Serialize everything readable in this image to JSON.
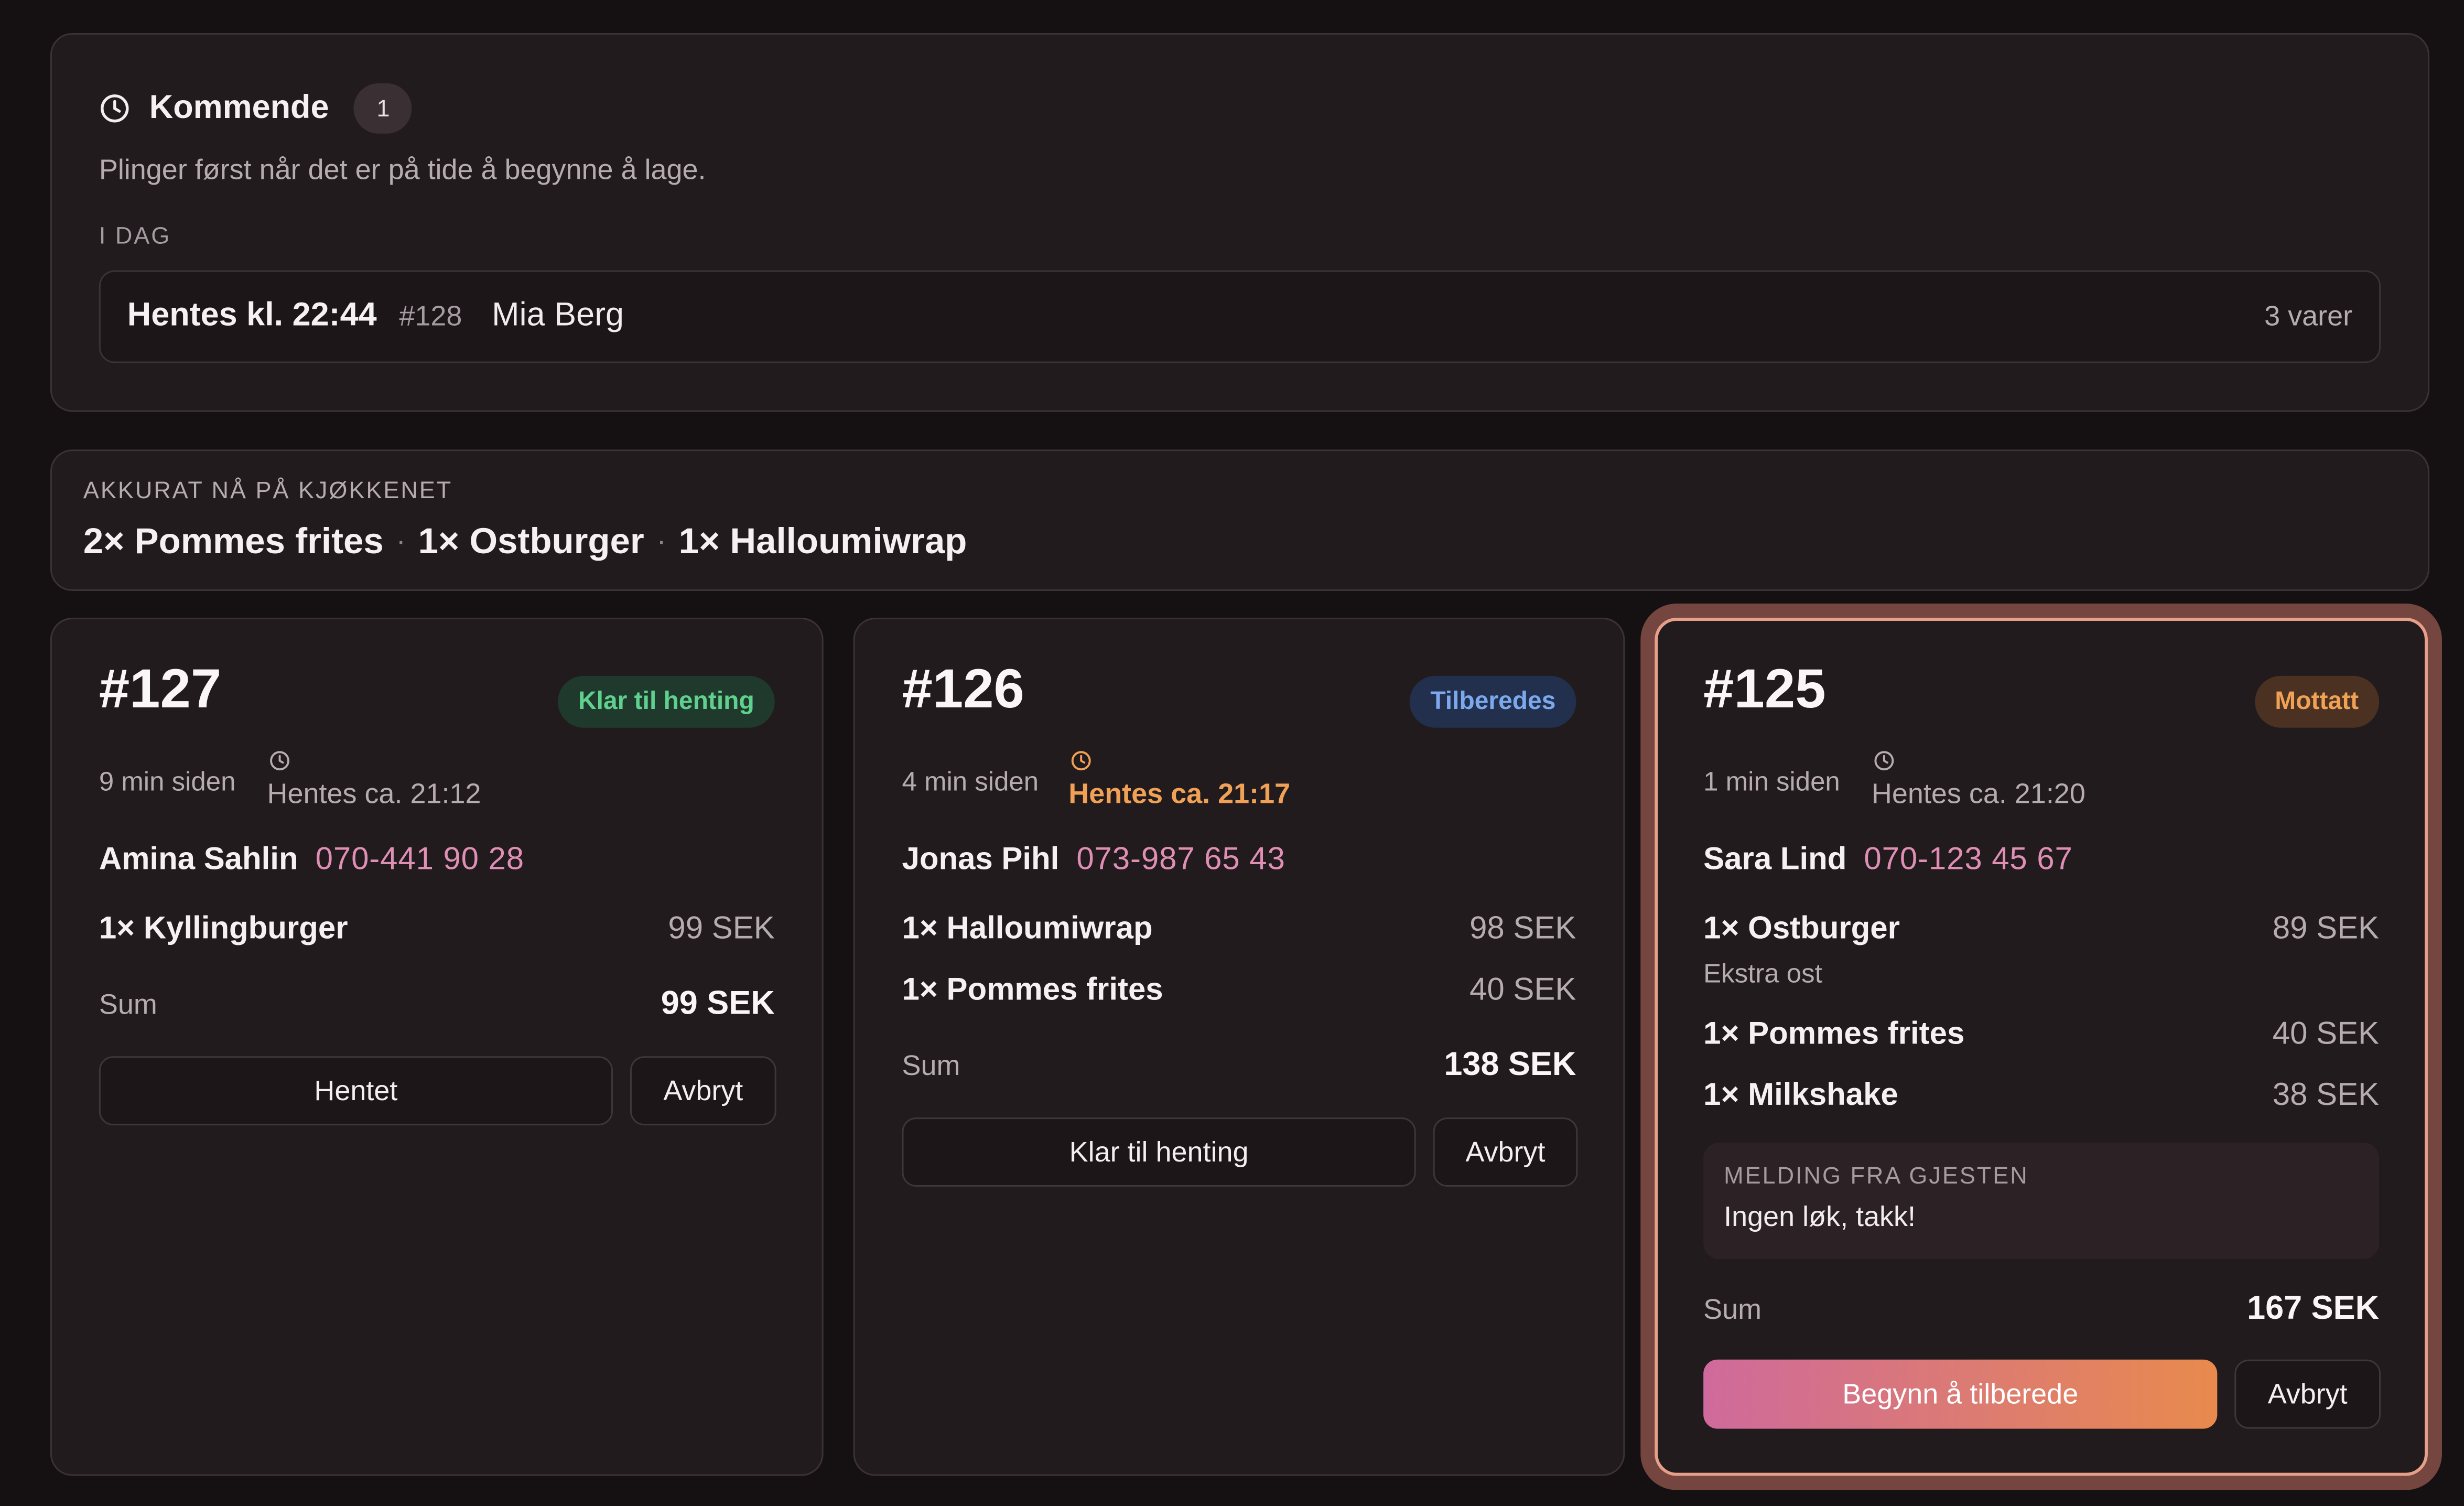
{
  "upcoming": {
    "title": "Kommende",
    "count": "1",
    "subtitle": "Plinger først når det er på tide å begynne å lage.",
    "day_label": "I DAG",
    "orders": [
      {
        "pickup": "Hentes kl. 22:44",
        "number": "#128",
        "customer": "Mia Berg",
        "items": "3 varer"
      }
    ]
  },
  "kitchen_now": {
    "label": "AKKURAT NÅ PÅ KJØKKENET",
    "items": [
      "2× Pommes frites",
      "1× Ostburger",
      "1× Halloumiwrap"
    ],
    "separator": "·"
  },
  "orders": [
    {
      "number": "#127",
      "status": "Klar til henting",
      "ago": "9 min siden",
      "pickup": "Hentes ca. 21:12",
      "customer": "Amina Sahlin",
      "phone": "070-441 90 28",
      "items": [
        {
          "name": "1× Kyllingburger",
          "price": "99 SEK"
        }
      ],
      "sum_label": "Sum",
      "sum": "99 SEK",
      "primary_action": "Hentet",
      "cancel_action": "Avbryt"
    },
    {
      "number": "#126",
      "status": "Tilberedes",
      "ago": "4 min siden",
      "pickup": "Hentes ca. 21:17",
      "customer": "Jonas Pihl",
      "phone": "073-987 65 43",
      "items": [
        {
          "name": "1× Halloumiwrap",
          "price": "98 SEK"
        },
        {
          "name": "1× Pommes frites",
          "price": "40 SEK"
        }
      ],
      "sum_label": "Sum",
      "sum": "138 SEK",
      "primary_action": "Klar til henting",
      "cancel_action": "Avbryt"
    },
    {
      "number": "#125",
      "status": "Mottatt",
      "ago": "1 min siden",
      "pickup": "Hentes ca. 21:20",
      "customer": "Sara Lind",
      "phone": "070-123 45 67",
      "items": [
        {
          "name": "1× Ostburger",
          "price": "89 SEK",
          "extra": "Ekstra ost"
        },
        {
          "name": "1× Pommes frites",
          "price": "40 SEK"
        },
        {
          "name": "1× Milkshake",
          "price": "38 SEK"
        }
      ],
      "note_label": "MELDING FRA GJESTEN",
      "note": "Ingen løk, takk!",
      "sum_label": "Sum",
      "sum": "167 SEK",
      "primary_action": "Begynn å tilberede",
      "cancel_action": "Avbryt"
    }
  ],
  "colors": {
    "background": "#151113",
    "panel": "#221b1e",
    "phone": "#e08fb4",
    "status_ready": "#5fd08d",
    "status_preparing": "#7ca9ee",
    "status_received": "#f0a155",
    "highlight_border": "#e6a08a"
  },
  "icons": {
    "clock": "clock-icon"
  }
}
